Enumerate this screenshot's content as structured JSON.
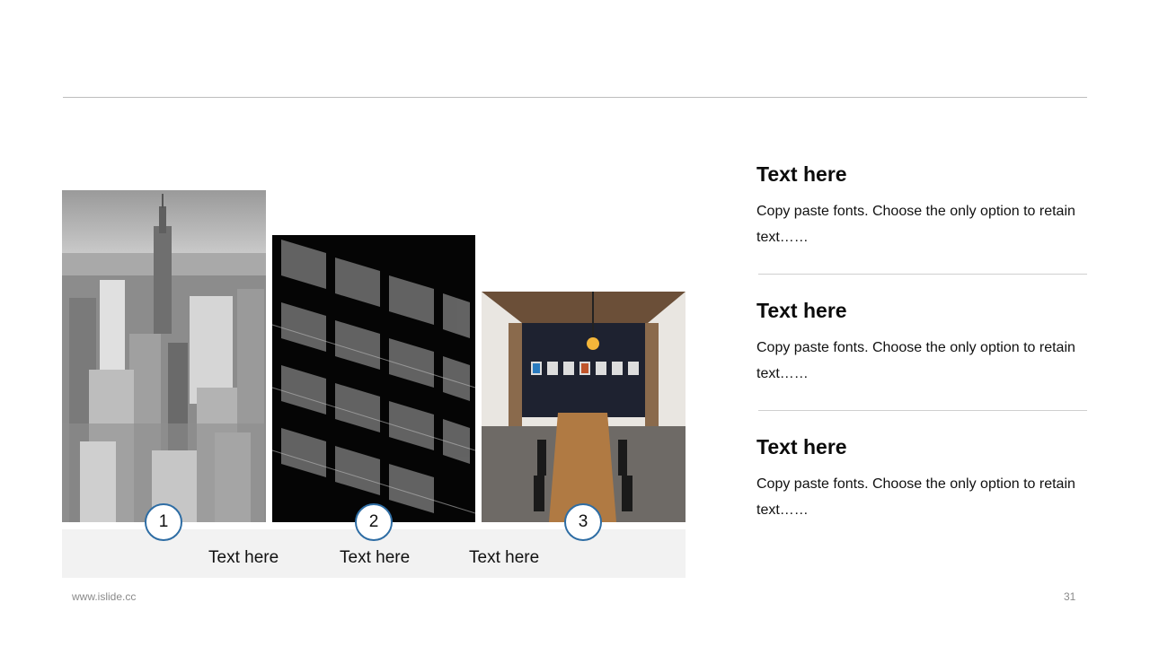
{
  "gallery": {
    "images": [
      {
        "subject": "city-skyline-bw-photo"
      },
      {
        "subject": "building-facade-bw-photo"
      },
      {
        "subject": "meeting-room-photo"
      }
    ],
    "badges": [
      "1",
      "2",
      "3"
    ],
    "captions": [
      "Text here",
      "Text here",
      "Text here"
    ],
    "badge_border_color": "#2e6da4",
    "band_color": "#f2f2f2"
  },
  "sections": [
    {
      "title": "Text here",
      "body": "Copy paste fonts. Choose the only option to retain text……"
    },
    {
      "title": "Text here",
      "body": "Copy paste fonts. Choose the only option to retain text……"
    },
    {
      "title": "Text here",
      "body": "Copy paste fonts. Choose the only option to retain text……"
    }
  ],
  "footer": {
    "url": "www.islide.cc",
    "page_number": "31"
  }
}
